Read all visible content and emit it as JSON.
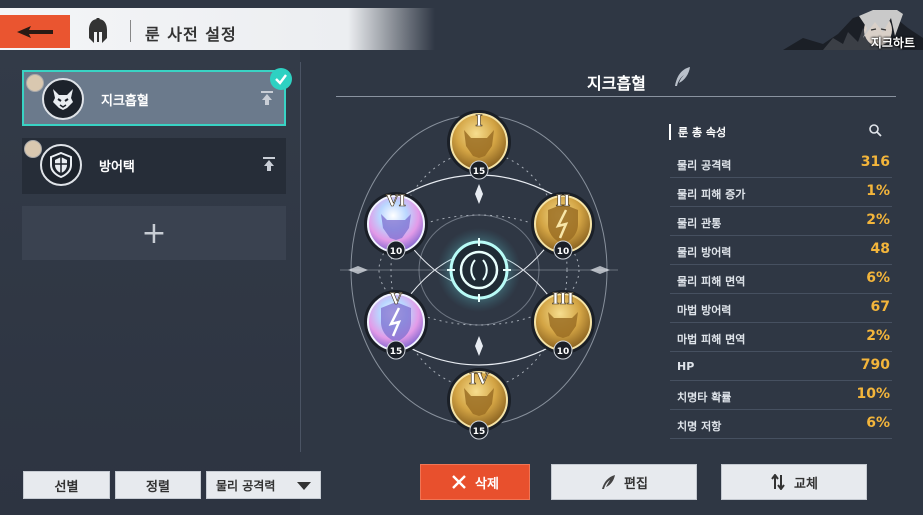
{
  "header": {
    "title": "룬 사전 설정",
    "character_name": "지크하트"
  },
  "presets": [
    {
      "label": "지크흡혈",
      "selected": true
    },
    {
      "label": "방어택",
      "selected": false
    }
  ],
  "add_slot": {
    "symbol": "+"
  },
  "bottom_controls": {
    "select_label": "선별",
    "sort_label": "정렬",
    "dropdown_value": "물리 공격력"
  },
  "rune_set": {
    "name": "지크흡혈",
    "runes": [
      {
        "slot": "I",
        "level": "15",
        "color": "gold"
      },
      {
        "slot": "II",
        "level": "10",
        "color": "gold"
      },
      {
        "slot": "III",
        "level": "10",
        "color": "gold"
      },
      {
        "slot": "IV",
        "level": "15",
        "color": "gold"
      },
      {
        "slot": "V",
        "level": "15",
        "color": "holo"
      },
      {
        "slot": "VI",
        "level": "10",
        "color": "holo"
      }
    ]
  },
  "stats": {
    "title": "룬 총 속성",
    "rows": [
      {
        "label": "물리 공격력",
        "value": "316"
      },
      {
        "label": "물리 피해 증가",
        "value": "1%"
      },
      {
        "label": "물리 관통",
        "value": "2%"
      },
      {
        "label": "물리 방어력",
        "value": "48"
      },
      {
        "label": "물리 피해 면역",
        "value": "6%"
      },
      {
        "label": "마법 방어력",
        "value": "67"
      },
      {
        "label": "마법 피해 면역",
        "value": "2%"
      },
      {
        "label": "HP",
        "value": "790"
      },
      {
        "label": "치명타 확률",
        "value": "10%"
      },
      {
        "label": "치명 저항",
        "value": "6%"
      }
    ]
  },
  "actions": {
    "delete_label": "삭제",
    "edit_label": "편집",
    "swap_label": "교체"
  },
  "colors": {
    "accent_orange": "#ea5530",
    "selection_teal": "#39d3c4",
    "stat_value": "#f3b53b"
  }
}
